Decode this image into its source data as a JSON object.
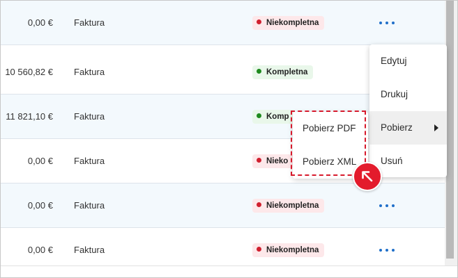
{
  "rows": [
    {
      "amount": "0,00 €",
      "type": "Faktura",
      "status": "Niekompletna",
      "status_kind": "incomplete"
    },
    {
      "amount": "10 560,82 €",
      "type": "Faktura",
      "status": "Kompletna",
      "status_kind": "complete"
    },
    {
      "amount": "11 821,10 €",
      "type": "Faktura",
      "status": "Komp",
      "status_kind": "complete"
    },
    {
      "amount": "0,00 €",
      "type": "Faktura",
      "status": "Nieko",
      "status_kind": "incomplete"
    },
    {
      "amount": "0,00 €",
      "type": "Faktura",
      "status": "Niekompletna",
      "status_kind": "incomplete"
    },
    {
      "amount": "0,00 €",
      "type": "Faktura",
      "status": "Niekompletna",
      "status_kind": "incomplete"
    }
  ],
  "context_menu": {
    "items": [
      "Edytuj",
      "Drukuj",
      "Pobierz",
      "Usuń"
    ],
    "active_item": "Pobierz"
  },
  "submenu": {
    "items": [
      "Pobierz PDF",
      "Pobierz XML"
    ]
  },
  "colors": {
    "incomplete_dot": "#d0202f",
    "complete_dot": "#1e8a1e",
    "accent": "#1f6fc9",
    "highlight": "#d7192b"
  },
  "icons": {
    "row_actions": "more-horizontal-icon",
    "submenu_caret": "caret-right-icon",
    "pointer": "arrow-up-left-icon"
  }
}
